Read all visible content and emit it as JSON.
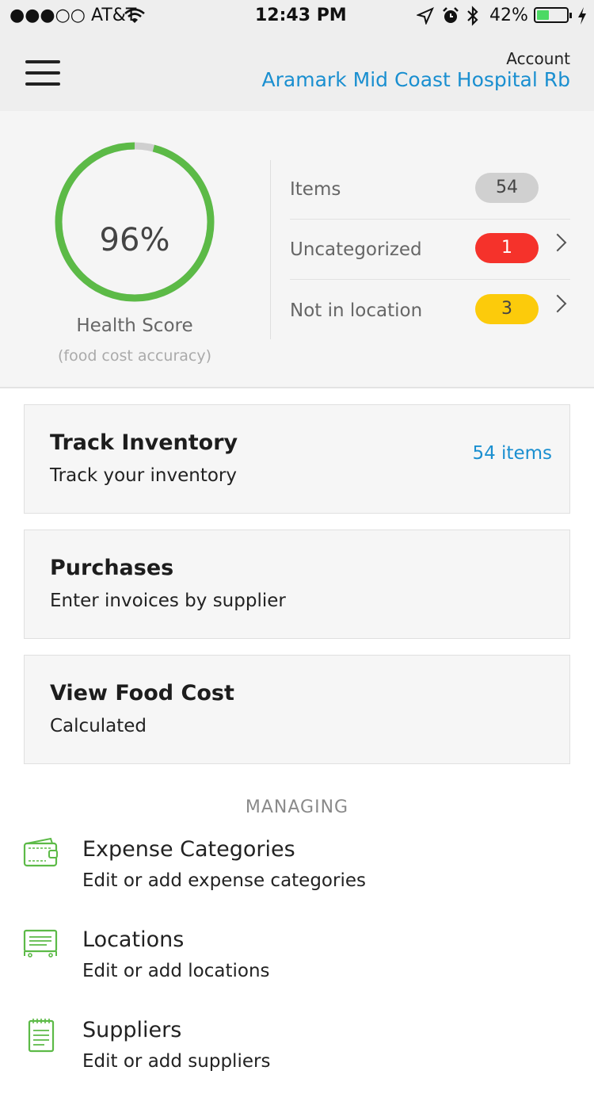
{
  "status_bar": {
    "carrier": "●●●○○ AT&T",
    "time": "12:43 PM",
    "battery": "42%",
    "battery_level": 0.42
  },
  "header": {
    "account_label": "Account",
    "account_name": "Aramark Mid Coast Hospital Rb"
  },
  "health": {
    "score_text": "96%",
    "score": 0.96,
    "title": "Health Score",
    "subtitle": "(food cost accuracy)",
    "rows": [
      {
        "label": "Items",
        "count": "54",
        "color": "#d0d0d0"
      },
      {
        "label": "Uncategorized",
        "count": "1",
        "color": "#f5322b"
      },
      {
        "label": "Not in location",
        "count": "3",
        "color": "#fccb0b"
      }
    ],
    "ring_color": "#5cba47"
  },
  "cards": [
    {
      "title": "Track Inventory",
      "subtitle": "Track your inventory",
      "right": "54 items"
    },
    {
      "title": "Purchases",
      "subtitle": "Enter invoices by supplier"
    },
    {
      "title": "View Food Cost",
      "subtitle": "Calculated"
    }
  ],
  "managing": {
    "heading": "MANAGING",
    "items": [
      {
        "title": "Expense Categories",
        "subtitle": "Edit or add expense categories",
        "icon": "wallet-icon"
      },
      {
        "title": "Locations",
        "subtitle": "Edit or add locations",
        "icon": "shelf-icon"
      },
      {
        "title": "Suppliers",
        "subtitle": "Edit or add suppliers",
        "icon": "notepad-icon"
      }
    ]
  },
  "colors": {
    "accent": "#1a8fd0",
    "icon_green": "#5cba47"
  }
}
